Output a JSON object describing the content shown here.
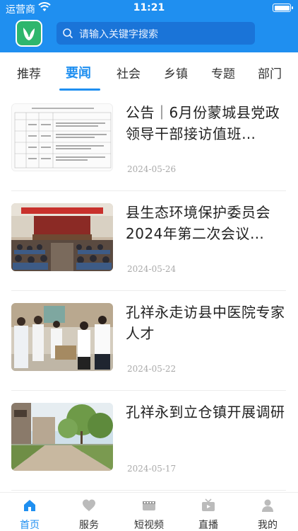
{
  "status_bar": {
    "carrier": "运营商",
    "time": "11:21"
  },
  "header": {
    "logo": "app-logo",
    "search_placeholder": "请输入关键字搜索"
  },
  "tabs": [
    {
      "label": "推荐",
      "active": false
    },
    {
      "label": "要闻",
      "active": true
    },
    {
      "label": "社会",
      "active": false
    },
    {
      "label": "乡镇",
      "active": false
    },
    {
      "label": "专题",
      "active": false
    },
    {
      "label": "部门",
      "active": false
    }
  ],
  "news": [
    {
      "title": "公告｜6月份蒙城县党政领导干部接访值班…",
      "date": "2024-05-26",
      "thumb": "document-table"
    },
    {
      "title": "县生态环境保护委员会2024年第二次会议…",
      "date": "2024-05-24",
      "thumb": "meeting-hall"
    },
    {
      "title": "孔祥永走访县中医院专家人才",
      "date": "2024-05-22",
      "thumb": "visit-group"
    },
    {
      "title": "孔祥永到立仓镇开展调研",
      "date": "2024-05-17",
      "thumb": "village-road"
    }
  ],
  "bottom_nav": [
    {
      "label": "首页",
      "icon": "home-icon",
      "active": true
    },
    {
      "label": "服务",
      "icon": "heart-icon",
      "active": false
    },
    {
      "label": "短视频",
      "icon": "film-icon",
      "active": false
    },
    {
      "label": "直播",
      "icon": "tv-icon",
      "active": false
    },
    {
      "label": "我的",
      "icon": "user-icon",
      "active": false
    }
  ],
  "colors": {
    "brand": "#1f8ff0",
    "logo": "#2eb66d"
  }
}
